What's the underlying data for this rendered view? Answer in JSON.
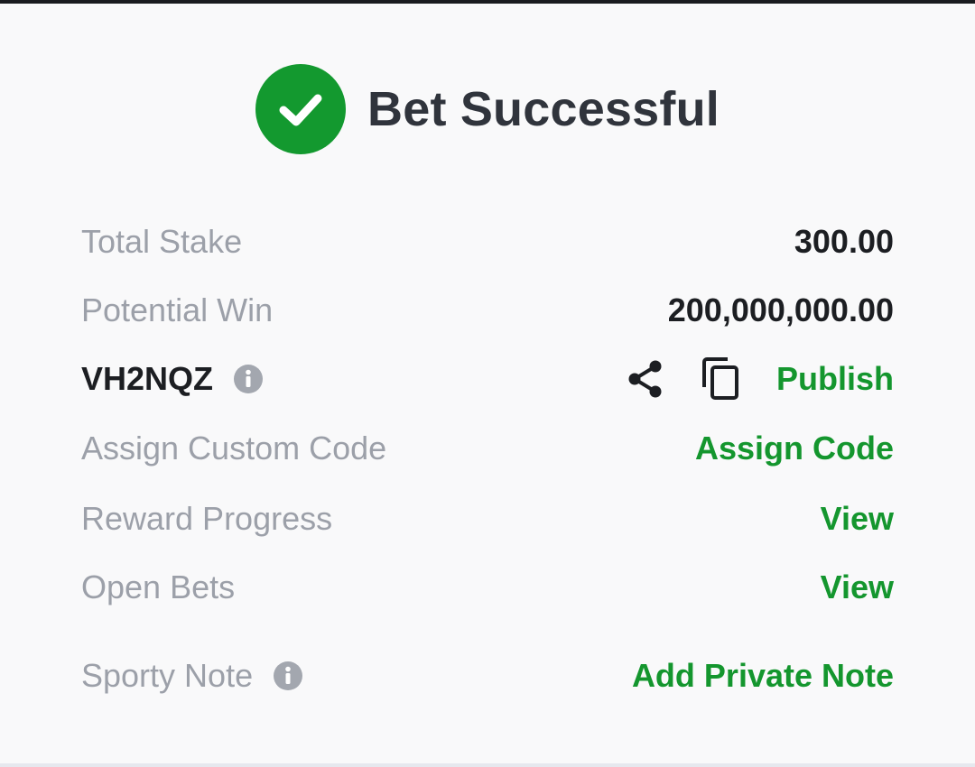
{
  "header": {
    "title": "Bet Successful",
    "success_color": "#13992f"
  },
  "summary": {
    "total_stake": {
      "label": "Total Stake",
      "value": "300.00"
    },
    "potential_win": {
      "label": "Potential Win",
      "value": "200,000,000.00"
    },
    "booking": {
      "code": "VH2NQZ",
      "share_icon": "share-icon",
      "copy_icon": "copy-icon",
      "publish_label": "Publish"
    },
    "custom_code": {
      "label": "Assign Custom Code",
      "action": "Assign Code"
    },
    "reward_progress": {
      "label": "Reward Progress",
      "action": "View"
    },
    "open_bets": {
      "label": "Open Bets",
      "action": "View"
    },
    "sporty_note": {
      "label": "Sporty Note",
      "action": "Add Private Note"
    }
  },
  "colors": {
    "link_green": "#14962e",
    "label_gray": "#9ca0a9",
    "value_dark": "#1c1e22",
    "title_dark": "#30343c"
  }
}
